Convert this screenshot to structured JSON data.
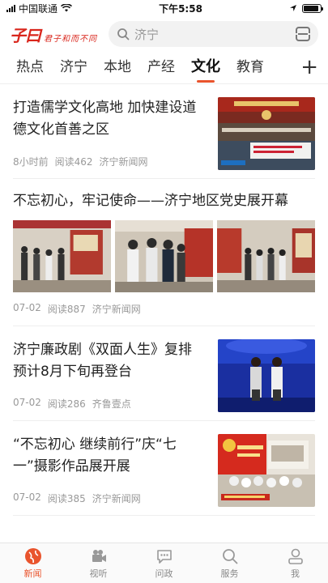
{
  "status": {
    "carrier": "中国联通",
    "time": "下午5:58"
  },
  "header": {
    "logo": "子曰",
    "slogan": "君子和而不同",
    "search_value": "济宁"
  },
  "tabs": [
    "热点",
    "济宁",
    "本地",
    "产经",
    "文化",
    "教育"
  ],
  "active_tab": 4,
  "news": [
    {
      "title": "打造儒学文化高地 加快建设道德文化首善之区",
      "time": "8小时前",
      "reads": "阅读462",
      "source": "济宁新闻网"
    },
    {
      "title": "不忘初心，牢记使命——济宁地区党史展开幕",
      "time": "07-02",
      "reads": "阅读887",
      "source": "济宁新闻网"
    },
    {
      "title": "济宁廉政剧《双面人生》复排 预计8月下旬再登台",
      "time": "07-02",
      "reads": "阅读286",
      "source": "齐鲁壹点"
    },
    {
      "title": "“不忘初心 继续前行”庆“七一”摄影作品展开展",
      "time": "07-02",
      "reads": "阅读385",
      "source": "济宁新闻网"
    }
  ],
  "bottom_tabs": [
    "新闻",
    "视听",
    "问政",
    "服务",
    "我"
  ],
  "colors": {
    "accent": "#e9542d",
    "brand_red": "#d9261c"
  }
}
